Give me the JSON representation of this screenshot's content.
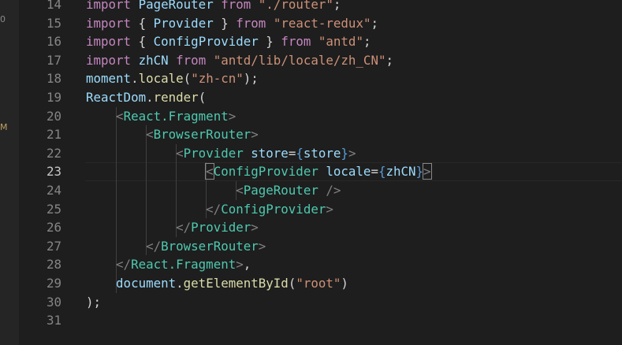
{
  "editor": {
    "line_numbers": [
      "14",
      "15",
      "16",
      "17",
      "18",
      "19",
      "20",
      "21",
      "22",
      "23",
      "24",
      "25",
      "26",
      "27",
      "28",
      "29",
      "30",
      "31"
    ],
    "current_line": "23",
    "lines": [
      [
        [
          "kw",
          "import"
        ],
        [
          "pl",
          " "
        ],
        [
          "id",
          "PageRouter"
        ],
        [
          "pl",
          " "
        ],
        [
          "kw",
          "from"
        ],
        [
          "pl",
          " "
        ],
        [
          "str",
          "\"./router\""
        ],
        [
          "pl",
          ";"
        ]
      ],
      [
        [
          "kw",
          "import"
        ],
        [
          "pl",
          " { "
        ],
        [
          "id",
          "Provider"
        ],
        [
          "pl",
          " } "
        ],
        [
          "kw",
          "from"
        ],
        [
          "pl",
          " "
        ],
        [
          "str",
          "\"react-redux\""
        ],
        [
          "pl",
          ";"
        ]
      ],
      [
        [
          "kw",
          "import"
        ],
        [
          "pl",
          " { "
        ],
        [
          "id",
          "ConfigProvider"
        ],
        [
          "pl",
          " } "
        ],
        [
          "kw",
          "from"
        ],
        [
          "pl",
          " "
        ],
        [
          "str",
          "\"antd\""
        ],
        [
          "pl",
          ";"
        ]
      ],
      [
        [
          "kw",
          "import"
        ],
        [
          "pl",
          " "
        ],
        [
          "id",
          "zhCN"
        ],
        [
          "pl",
          " "
        ],
        [
          "kw",
          "from"
        ],
        [
          "pl",
          " "
        ],
        [
          "str",
          "\"antd/lib/locale/zh_CN\""
        ],
        [
          "pl",
          ";"
        ]
      ],
      [
        [
          "id",
          "moment"
        ],
        [
          "pl",
          "."
        ],
        [
          "fn",
          "locale"
        ],
        [
          "pl",
          "("
        ],
        [
          "str",
          "\"zh-cn\""
        ],
        [
          "pl",
          ");"
        ]
      ],
      [
        [
          "id",
          "ReactDom"
        ],
        [
          "pl",
          "."
        ],
        [
          "fn",
          "render"
        ],
        [
          "pl",
          "("
        ]
      ],
      [
        [
          "pl",
          "    "
        ],
        [
          "br",
          "<"
        ],
        [
          "tag",
          "React.Fragment"
        ],
        [
          "br",
          ">"
        ]
      ],
      [
        [
          "pl",
          "        "
        ],
        [
          "br",
          "<"
        ],
        [
          "tag",
          "BrowserRouter"
        ],
        [
          "br",
          ">"
        ]
      ],
      [
        [
          "pl",
          "            "
        ],
        [
          "br",
          "<"
        ],
        [
          "tag",
          "Provider"
        ],
        [
          "pl",
          " "
        ],
        [
          "attr",
          "store"
        ],
        [
          "pl",
          "="
        ],
        [
          "bj",
          "{"
        ],
        [
          "id",
          "store"
        ],
        [
          "bj",
          "}"
        ],
        [
          "br",
          ">"
        ]
      ],
      [
        [
          "pl",
          "                "
        ],
        [
          "br",
          "<"
        ],
        [
          "tag",
          "ConfigProvider"
        ],
        [
          "pl",
          " "
        ],
        [
          "attr",
          "locale"
        ],
        [
          "pl",
          "="
        ],
        [
          "bj",
          "{"
        ],
        [
          "id",
          "zhCN"
        ],
        [
          "bj",
          "}"
        ],
        [
          "br",
          ">"
        ]
      ],
      [
        [
          "pl",
          "                    "
        ],
        [
          "br",
          "<"
        ],
        [
          "tag",
          "PageRouter"
        ],
        [
          "pl",
          " "
        ],
        [
          "br",
          "/>"
        ]
      ],
      [
        [
          "pl",
          "                "
        ],
        [
          "br",
          "</"
        ],
        [
          "tag",
          "ConfigProvider"
        ],
        [
          "br",
          ">"
        ]
      ],
      [
        [
          "pl",
          "            "
        ],
        [
          "br",
          "</"
        ],
        [
          "tag",
          "Provider"
        ],
        [
          "br",
          ">"
        ]
      ],
      [
        [
          "pl",
          "        "
        ],
        [
          "br",
          "</"
        ],
        [
          "tag",
          "BrowserRouter"
        ],
        [
          "br",
          ">"
        ]
      ],
      [
        [
          "pl",
          "    "
        ],
        [
          "br",
          "</"
        ],
        [
          "tag",
          "React.Fragment"
        ],
        [
          "br",
          ">"
        ],
        [
          "pl",
          ","
        ]
      ],
      [
        [
          "pl",
          "    "
        ],
        [
          "id",
          "document"
        ],
        [
          "pl",
          "."
        ],
        [
          "fn",
          "getElementById"
        ],
        [
          "pl",
          "("
        ],
        [
          "str",
          "\"root\""
        ],
        [
          "pl",
          ")"
        ]
      ],
      [
        [
          "pl",
          ");"
        ]
      ],
      []
    ],
    "guides": [
      [],
      [],
      [],
      [],
      [],
      [],
      [
        1
      ],
      [
        1,
        2
      ],
      [
        1,
        2,
        3
      ],
      [
        1,
        2,
        3,
        4
      ],
      [
        1,
        2,
        3,
        4,
        5
      ],
      [
        1,
        2,
        3,
        4
      ],
      [
        1,
        2,
        3
      ],
      [
        1,
        2
      ],
      [
        1
      ],
      [
        1
      ],
      [],
      []
    ]
  },
  "gutter": {
    "marker_top": "0",
    "marker_modified": "M"
  }
}
